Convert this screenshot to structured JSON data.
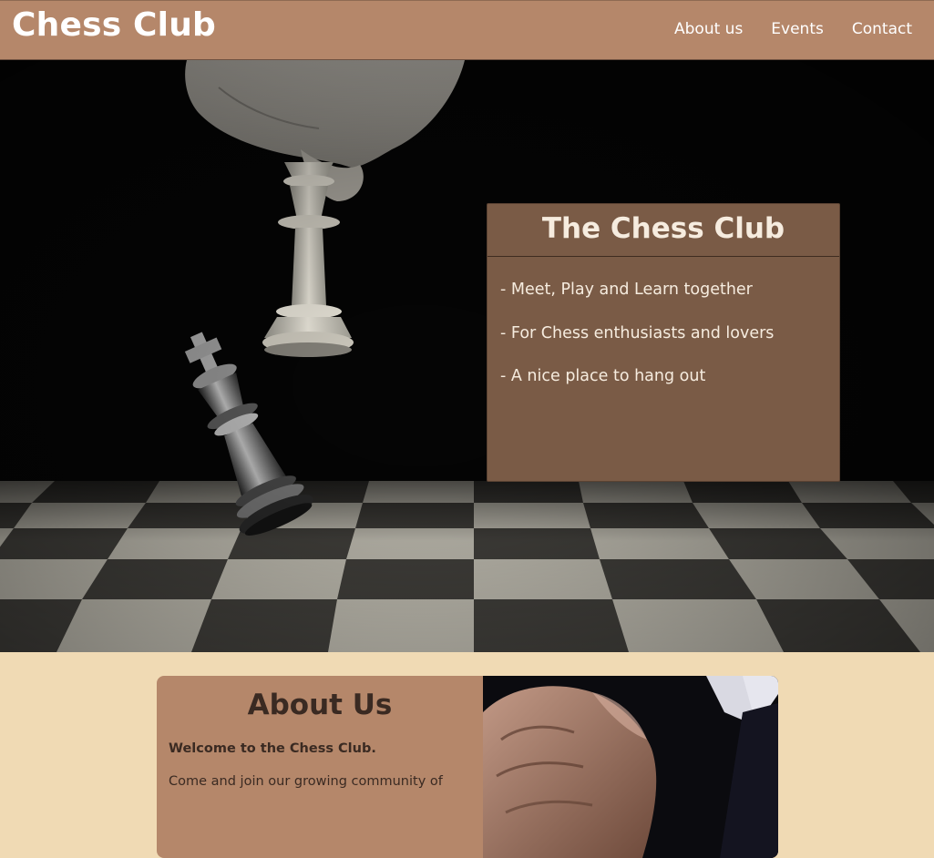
{
  "header": {
    "brand": "Chess Club",
    "nav": [
      {
        "label": "About us"
      },
      {
        "label": "Events"
      },
      {
        "label": "Contact"
      }
    ]
  },
  "hero": {
    "image_icon": "chess-photo",
    "card": {
      "title": "The Chess Club",
      "items": [
        "- Meet, Play and Learn together",
        "- For Chess enthusiasts and lovers",
        "- A nice place to hang out"
      ]
    }
  },
  "about": {
    "title": "About Us",
    "welcome": "Welcome to the Chess Club.",
    "body": "Come and join our growing community of",
    "image_icon": "hand-on-chess-piece-photo"
  },
  "colors": {
    "header_bg": "#b5876a",
    "page_bg": "#f0dab4",
    "card_bg": "#7e5e48",
    "text_dark": "#3a2a22",
    "text_light": "#ffffff"
  }
}
